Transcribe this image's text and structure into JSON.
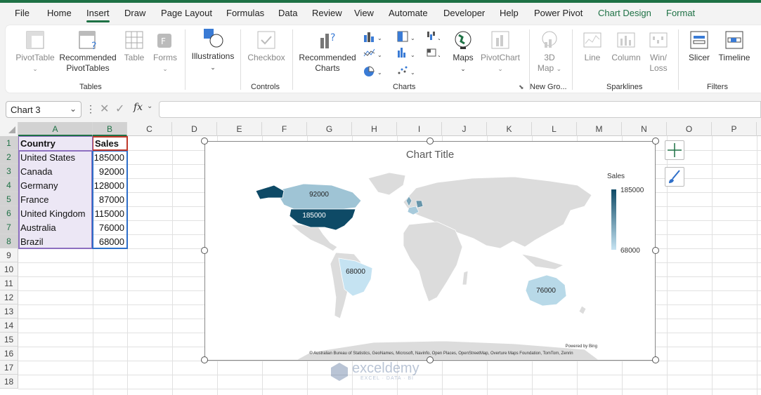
{
  "tabs": [
    "File",
    "Home",
    "Insert",
    "Draw",
    "Page Layout",
    "Formulas",
    "Data",
    "Review",
    "View",
    "Automate",
    "Developer",
    "Help",
    "Power Pivot",
    "Chart Design",
    "Format"
  ],
  "ribbon": {
    "pivottable": "PivotTable",
    "rec_pivot_1": "Recommended",
    "rec_pivot_2": "PivotTables",
    "table": "Table",
    "forms": "Forms",
    "illustrations": "Illustrations",
    "checkbox": "Checkbox",
    "rec_charts_1": "Recommended",
    "rec_charts_2": "Charts",
    "maps": "Maps",
    "pivotchart": "PivotChart",
    "map3d_1": "3D",
    "map3d_2": "Map",
    "line": "Line",
    "column": "Column",
    "winloss_1": "Win/",
    "winloss_2": "Loss",
    "slicer": "Slicer",
    "timeline": "Timeline",
    "groups": {
      "tables": "Tables",
      "controls": "Controls",
      "charts": "Charts",
      "newgro": "New Gro...",
      "sparklines": "Sparklines",
      "filters": "Filters"
    }
  },
  "formula_bar": {
    "name_box": "Chart 3",
    "fx": "fx",
    "value": ""
  },
  "columns": [
    "A",
    "B",
    "C",
    "D",
    "E",
    "F",
    "G",
    "H",
    "I",
    "J",
    "K",
    "L",
    "M",
    "N",
    "O",
    "P"
  ],
  "rows": [
    "1",
    "2",
    "3",
    "4",
    "5",
    "6",
    "7",
    "8",
    "9",
    "10",
    "11",
    "12",
    "13",
    "14",
    "15",
    "16",
    "17",
    "18"
  ],
  "table": {
    "headers": [
      "Country",
      "Sales"
    ],
    "rows": [
      [
        "United States",
        "185000"
      ],
      [
        "Canada",
        "92000"
      ],
      [
        "Germany",
        "128000"
      ],
      [
        "France",
        "87000"
      ],
      [
        "United Kingdom",
        "115000"
      ],
      [
        "Australia",
        "76000"
      ],
      [
        "Brazil",
        "68000"
      ]
    ]
  },
  "chart": {
    "title": "Chart Title",
    "legend_title": "Sales",
    "legend_max": "185000",
    "legend_min": "68000",
    "labels": {
      "us": "185000",
      "canada": "92000",
      "brazil": "68000",
      "australia": "76000"
    },
    "powered": "Powered by Bing",
    "attribution": "© Australian Bureau of Statistics, GeoNames, Microsoft, Navinfo, Open Places, OpenStreetMap, Overture Maps Foundation, TomTom, Zenrin",
    "colors": {
      "max": "#0e4a66",
      "min": "#c5e3f2",
      "land": "#dcdcdc"
    }
  },
  "watermark": {
    "brand": "exceldemy",
    "tag": "EXCEL · DATA · BI"
  },
  "chart_data": {
    "type": "map",
    "title": "Chart Title",
    "series": [
      {
        "name": "Sales",
        "categories": [
          "United States",
          "Canada",
          "Germany",
          "France",
          "United Kingdom",
          "Australia",
          "Brazil"
        ],
        "values": [
          185000,
          92000,
          128000,
          87000,
          115000,
          76000,
          68000
        ]
      }
    ],
    "color_scale": {
      "min": 68000,
      "max": 185000
    }
  }
}
